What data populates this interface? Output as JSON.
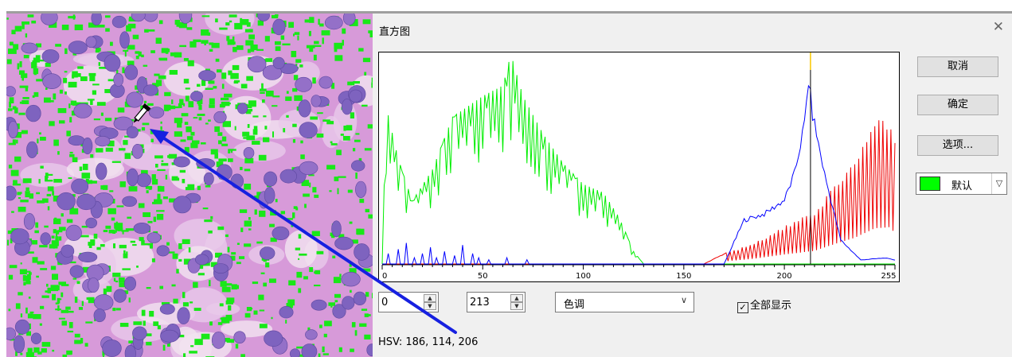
{
  "dialog": {
    "title": "直方图",
    "close_icon": "close-icon",
    "buttons": {
      "cancel": "取消",
      "ok": "确定",
      "options": "选项..."
    },
    "color_dropdown": {
      "label": "默认",
      "swatch_color": "#00ff00"
    }
  },
  "histogram": {
    "x_ticks": [
      "0",
      "50",
      "100",
      "150",
      "200",
      "255"
    ],
    "range_min": "0",
    "range_max": "213",
    "mode_dropdown": "色调",
    "show_all_label": "全部显示",
    "show_all_checked": true,
    "cursor_value": 213,
    "series_colors": {
      "green": "#00ee00",
      "blue": "#0000ff",
      "red": "#ee0000"
    }
  },
  "readout": {
    "hsv": "HSV: 186, 114, 206"
  },
  "image_panel": {
    "icon": "eyedropper-icon"
  },
  "colors": {
    "stain_purple": "#cf8fd6",
    "nuclei": "#7e63bf",
    "highlight_green": "#18e818",
    "arrow_blue": "#1620e0"
  }
}
